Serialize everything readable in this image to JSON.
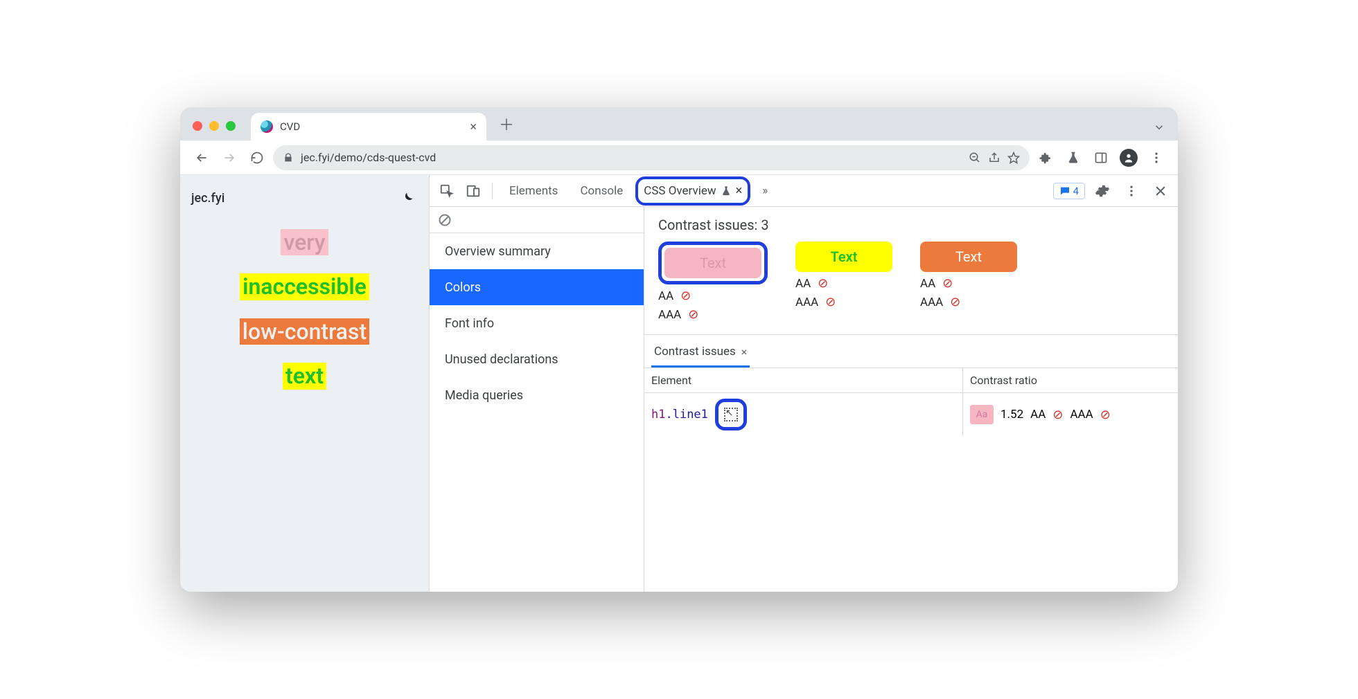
{
  "browser": {
    "tab_title": "CVD",
    "url": "jec.fyi/demo/cds-quest-cvd"
  },
  "page": {
    "site_title": "jec.fyi",
    "words": [
      "very",
      "inaccessible",
      "low-contrast",
      "text"
    ]
  },
  "devtools": {
    "tabs": [
      "Elements",
      "Console",
      "CSS Overview"
    ],
    "active_tab": "CSS Overview",
    "messages_count": "4",
    "sidebar": {
      "items": [
        "Overview summary",
        "Colors",
        "Font info",
        "Unused declarations",
        "Media queries"
      ],
      "active": "Colors"
    },
    "contrast": {
      "heading": "Contrast issues: 3",
      "swatch_label": "Text",
      "aa_label": "AA",
      "aaa_label": "AAA",
      "results_tab": "Contrast issues",
      "columns": {
        "element": "Element",
        "ratio": "Contrast ratio"
      },
      "row": {
        "selector_tag": "h1",
        "selector_class": ".line1",
        "ratio_sample": "Aa",
        "ratio_value": "1.52",
        "aa": "AA",
        "aaa": "AAA"
      }
    }
  }
}
